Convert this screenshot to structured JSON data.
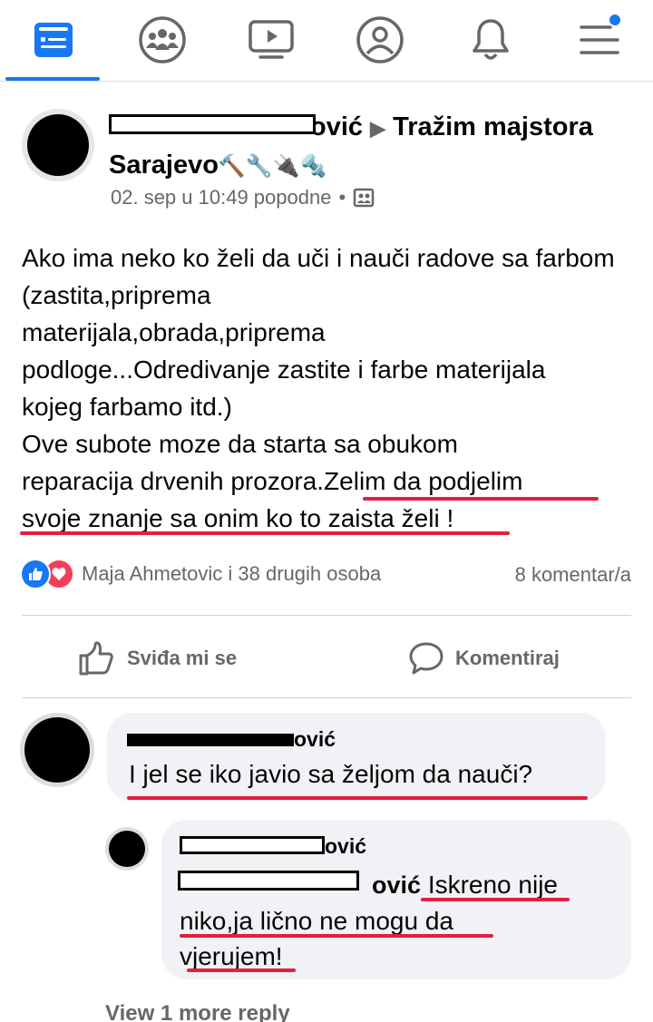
{
  "nav": {
    "items": [
      {
        "icon": "news-feed-icon",
        "active": true
      },
      {
        "icon": "groups-icon",
        "active": false
      },
      {
        "icon": "watch-icon",
        "active": false
      },
      {
        "icon": "profile-icon",
        "active": false
      },
      {
        "icon": "bell-icon",
        "active": false
      },
      {
        "icon": "menu-icon",
        "active": false,
        "badge": true
      }
    ],
    "accent": "#1877f2",
    "icon_color": "#65676b"
  },
  "post": {
    "author_suffix": "ović",
    "arrow": "▶",
    "group": "Tražim majstora Sarajevo",
    "group_emojis": "🔨🔧🔌🔩",
    "timestamp": "02. sep u 10:49 popodne",
    "separator": "•",
    "body_lines": [
      "Ako ima neko ko želi da uči i nauči radove sa farbom (zastita,priprema",
      "materijala,obrada,priprema",
      "podloge...Odredivanje zastite i farbe materijala",
      "kojeg farbamo itd.)",
      "Ove subote moze da starta sa obukom",
      "reparacija drvenih prozora.Zelim da podjelim",
      "svoje znanje sa onim ko to zaista želi !"
    ],
    "reactions_text": "Maja Ahmetovic i 38 drugih osoba",
    "comments_count": "8 komentar/a",
    "underline_color": "#e41e3f"
  },
  "actions": {
    "like_label": "Sviđa mi se",
    "comment_label": "Komentiraj"
  },
  "comments": [
    {
      "name_suffix": "ović",
      "text": "I jel se iko javio sa željom da nauči?"
    },
    {
      "name_suffix": "ović",
      "mention_suffix": "ović",
      "text_line1": "Iskreno nije",
      "text_line2": "niko,ja lično ne mogu da",
      "text_line3": "vjerujem!"
    }
  ],
  "view_more": "View 1 more reply"
}
